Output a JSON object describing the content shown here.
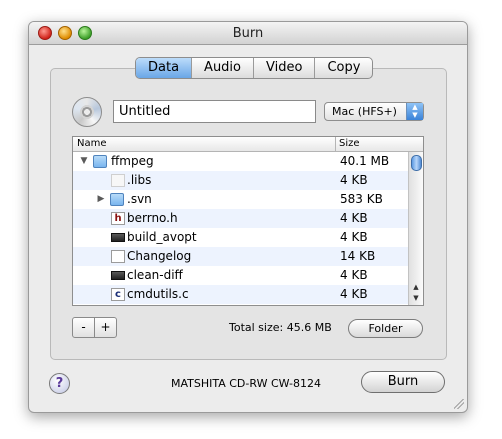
{
  "window": {
    "title": "Burn"
  },
  "tabs": [
    {
      "label": "Data",
      "selected": true
    },
    {
      "label": "Audio",
      "selected": false
    },
    {
      "label": "Video",
      "selected": false
    },
    {
      "label": "Copy",
      "selected": false
    }
  ],
  "disc": {
    "name_value": "Untitled",
    "format_selected": "Mac (HFS+)"
  },
  "table": {
    "headers": {
      "name": "Name",
      "size": "Size"
    },
    "rows": [
      {
        "name": "ffmpeg",
        "size": "40.1 MB",
        "icon": "folder-icon",
        "disclosure": "expanded",
        "depth": 0
      },
      {
        "name": ".libs",
        "size": "4 KB",
        "icon": "document-icon",
        "disclosure": "none",
        "depth": 1
      },
      {
        "name": ".svn",
        "size": "583 KB",
        "icon": "folder-icon",
        "disclosure": "collapsed",
        "depth": 1
      },
      {
        "name": "berrno.h",
        "size": "4 KB",
        "icon": "h-file-icon",
        "disclosure": "none",
        "depth": 1
      },
      {
        "name": "build_avopt",
        "size": "4 KB",
        "icon": "executable-icon",
        "disclosure": "none",
        "depth": 1
      },
      {
        "name": "Changelog",
        "size": "14 KB",
        "icon": "document-icon",
        "disclosure": "none",
        "depth": 1
      },
      {
        "name": "clean-diff",
        "size": "4 KB",
        "icon": "executable-icon",
        "disclosure": "none",
        "depth": 1
      },
      {
        "name": "cmdutils.c",
        "size": "4 KB",
        "icon": "c-file-icon",
        "disclosure": "none",
        "depth": 1
      }
    ]
  },
  "controls": {
    "minus_label": "-",
    "plus_label": "+"
  },
  "footer": {
    "total_label": "Total size:",
    "total_value": "45.6 MB",
    "folder_button": "Folder",
    "help_label": "?",
    "device_name": "MATSHITA CD-RW CW-8124",
    "burn_button": "Burn"
  }
}
